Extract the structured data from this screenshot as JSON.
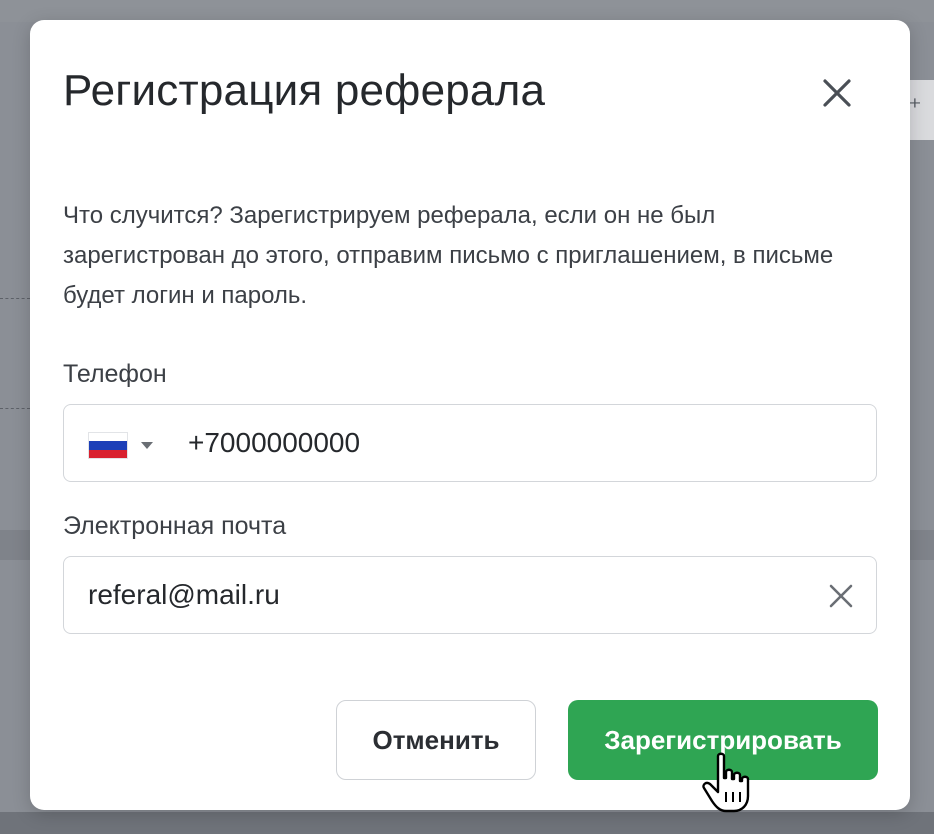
{
  "modal": {
    "title": "Регистрация реферала",
    "description": "Что случится? Зарегистрируем реферала, если он не был зарегистрован до этого, отправим письмо с приглашением, в письме будет логин и пароль."
  },
  "phone": {
    "label": "Телефон",
    "country_flag": "russia-flag-icon",
    "value": "+7000000000"
  },
  "email": {
    "label": "Электронная почта",
    "value": "referal@mail.ru"
  },
  "buttons": {
    "cancel": "Отменить",
    "submit": "Зарегистрировать"
  },
  "colors": {
    "primary": "#2fa553",
    "overlay": "#8b8f96"
  }
}
